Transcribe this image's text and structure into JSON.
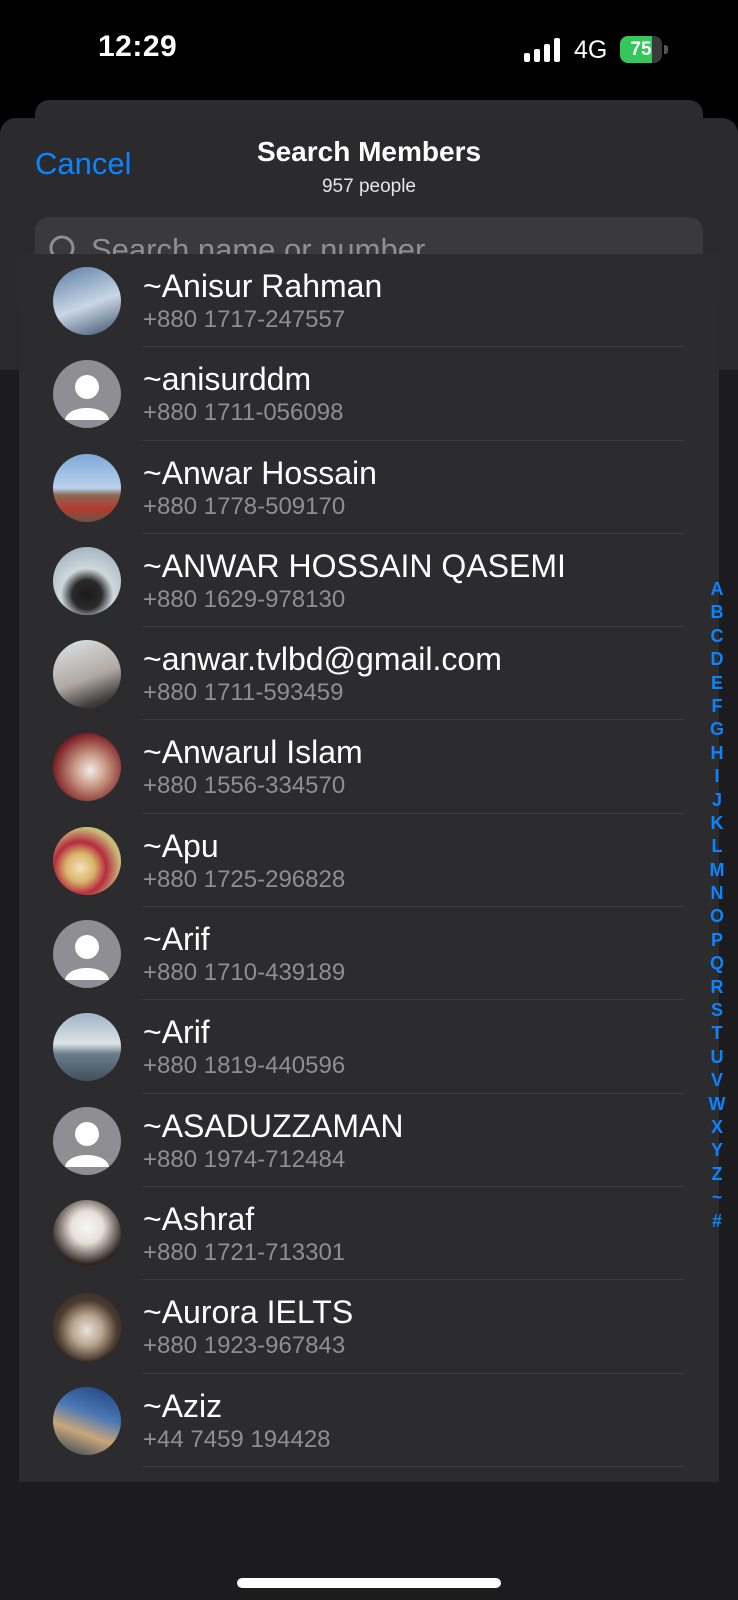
{
  "status": {
    "time": "12:29",
    "network": "4G",
    "battery_level": "75",
    "battery_fraction": 0.75,
    "battery_color": "#34c759"
  },
  "header": {
    "cancel_label": "Cancel",
    "title": "Search Members",
    "subtitle": "957 people"
  },
  "search": {
    "placeholder": "Search name or number",
    "value": "",
    "icon": "magnifier"
  },
  "section": {
    "label": "~"
  },
  "members": [
    {
      "name": "~Anisur Rahman",
      "phone": "+880 1717-247557",
      "avatar": "photo"
    },
    {
      "name": "~anisurddm",
      "phone": "+880 1711-056098",
      "avatar": "placeholder"
    },
    {
      "name": "~Anwar Hossain",
      "phone": "+880 1778-509170",
      "avatar": "photo"
    },
    {
      "name": "~ANWAR HOSSAIN QASEMI",
      "phone": "+880 1629-978130",
      "avatar": "photo"
    },
    {
      "name": "~anwar.tvlbd@gmail.com",
      "phone": "+880 1711-593459",
      "avatar": "photo"
    },
    {
      "name": "~Anwarul Islam",
      "phone": "+880 1556-334570",
      "avatar": "photo"
    },
    {
      "name": "~Apu",
      "phone": "+880 1725-296828",
      "avatar": "photo"
    },
    {
      "name": "~Arif",
      "phone": "+880 1710-439189",
      "avatar": "placeholder"
    },
    {
      "name": "~Arif",
      "phone": "+880 1819-440596",
      "avatar": "photo"
    },
    {
      "name": "~ASADUZZAMAN",
      "phone": "+880 1974-712484",
      "avatar": "placeholder"
    },
    {
      "name": "~Ashraf",
      "phone": "+880 1721-713301",
      "avatar": "photo"
    },
    {
      "name": "~Aurora IELTS",
      "phone": "+880 1923-967843",
      "avatar": "photo"
    },
    {
      "name": "~Aziz",
      "phone": "+44 7459 194428",
      "avatar": "photo"
    }
  ],
  "index_letters": [
    "A",
    "B",
    "C",
    "D",
    "E",
    "F",
    "G",
    "H",
    "I",
    "J",
    "K",
    "L",
    "M",
    "N",
    "O",
    "P",
    "Q",
    "R",
    "S",
    "T",
    "U",
    "V",
    "W",
    "X",
    "Y",
    "Z",
    "~",
    "#"
  ],
  "colors": {
    "accent": "#0a84ff",
    "background": "#1c1c1e",
    "row_background": "#2c2c2e",
    "secondary_text": "#8e8e93"
  }
}
